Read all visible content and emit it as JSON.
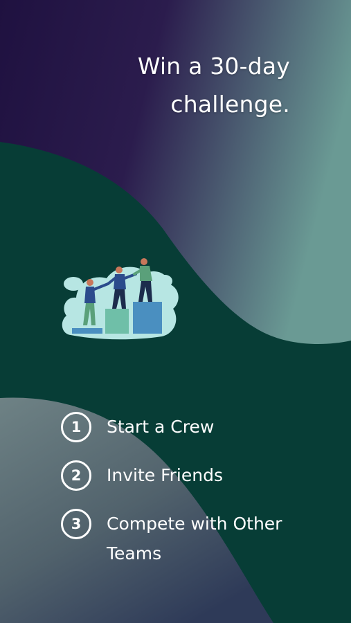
{
  "headline": {
    "line1": "Win a 30-day",
    "line2": "challenge."
  },
  "illustration": {
    "icon": "team-climbing-steps-icon"
  },
  "steps": [
    {
      "number": "1",
      "label": "Start a Crew"
    },
    {
      "number": "2",
      "label": "Invite Friends"
    },
    {
      "number": "3",
      "label": "Compete with Other Teams"
    }
  ],
  "colors": {
    "deep_purple": "#1f1140",
    "dark_teal": "#073d36",
    "slate_gray": "#5e6f73",
    "light_teal_accent": "#b7e6e3",
    "text_white": "#ffffff"
  }
}
